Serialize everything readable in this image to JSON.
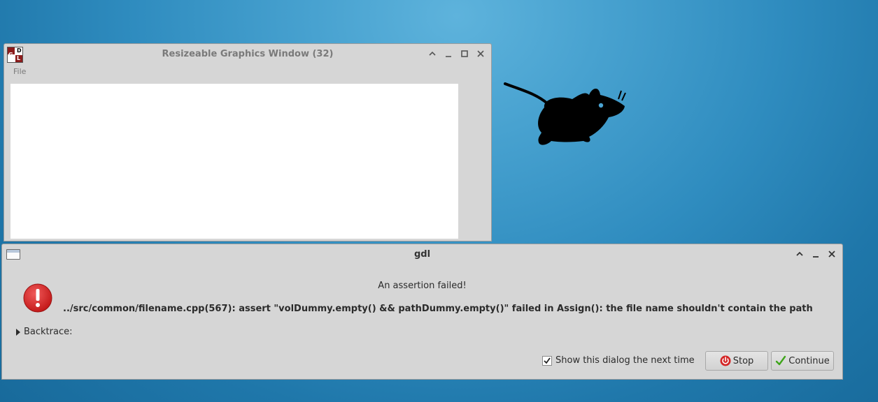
{
  "graphics_window": {
    "title": "Resizeable Graphics Window (32)",
    "menu": {
      "file_label": "File"
    },
    "logo_letters": [
      "G",
      "D",
      "L"
    ]
  },
  "dialog": {
    "title": "gdl",
    "heading": "An assertion failed!",
    "message": "../src/common/filename.cpp(567): assert \"volDummy.empty() && pathDummy.empty()\" failed in Assign(): the file name shouldn't contain the path",
    "backtrace_label": "Backtrace:",
    "show_dialog_label": "Show this dialog the next time",
    "show_dialog_checked": true,
    "stop_label": "Stop",
    "continue_label": "Continue"
  },
  "colors": {
    "desktop_bg": "#2f8cbf",
    "window_bg": "#d6d6d6",
    "error_red": "#d42525",
    "continue_check": "#3fa51b"
  },
  "icons": {
    "window_controls": [
      "chevron-up-icon",
      "minimize-icon",
      "maximize-icon",
      "close-icon"
    ],
    "dialog_controls": [
      "chevron-up-icon",
      "minimize-icon",
      "close-icon"
    ],
    "error": "error-exclamation-icon",
    "stop": "power-icon",
    "continue": "checkmark-icon",
    "desktop": "xfce-mouse-icon"
  }
}
